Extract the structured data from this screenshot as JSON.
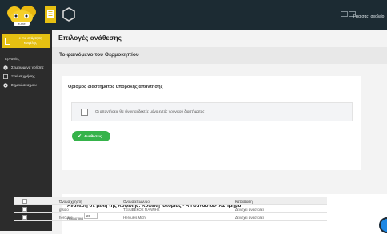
{
  "header": {
    "logo_text": "e-me",
    "user_name": "Γεια σας, σχολείο"
  },
  "sidebar": {
    "active_item": {
      "label": "e-me ανάρτηση Κυψέλης"
    },
    "section_title": "Εργασίες",
    "items": [
      {
        "label": "Σημειωμένα χρήσης",
        "icon": "info-circle-icon"
      },
      {
        "label": "Ξεκίνα χρήσης",
        "icon": "document-icon"
      },
      {
        "label": "Σημειώσεις μου",
        "icon": "target-icon"
      }
    ]
  },
  "main": {
    "page_title": "Επιλογές ανάθεσης",
    "subheader": "Το φαινόμενο του Θερμοκηπίου",
    "time_card": {
      "title": "Ορισμός διαστήματος υποβολής απάντησης",
      "checkbox_text": "Οι απαντήσεις θα γίνονται δεκτές μόνο εντός χρονικού διαστήματος",
      "button_label": "Ανάθεσεις",
      "button_icon": "check-icon"
    },
    "members_card": {
      "title": "Ανάθεση σε μέλη της Κυψέλης: Κυψέλη Ιστορίας - Α΄Γυμνασίου- Α2 Τμήμα",
      "show_label": "Αναλυτικά",
      "page_size": "20",
      "columns": [
        "",
        "Όνομα χρήστη",
        "Ονοματεπώνυμο",
        "Κατάσταση"
      ],
      "rows": [
        {
          "username": "gtsolo",
          "fullname": "ΤΣΙΛΙΒΕΚΟΣ ΓΙΑΝΝΗΣ",
          "status": "Δεν έχει αναστολεί"
        },
        {
          "username": "hercules",
          "fullname": "Hercules Mich",
          "status": "Δεν έχει αναστολεί"
        }
      ]
    }
  },
  "colors": {
    "topbar": "#1c2b33",
    "sidebar": "#2c2c2c",
    "accent_yellow": "#e6c012",
    "button_green": "#35b34a"
  }
}
